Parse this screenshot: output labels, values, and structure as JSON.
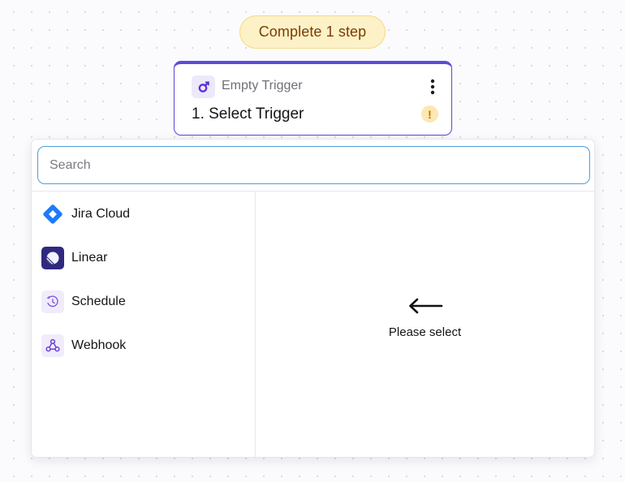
{
  "badge": {
    "label": "Complete 1 step"
  },
  "trigger_card": {
    "type_label": "Empty Trigger",
    "title": "1. Select Trigger",
    "icon": "trigger-icon",
    "warning_icon": "exclamation-icon",
    "warning_symbol": "!",
    "accent_color": "#5b4bd8"
  },
  "search": {
    "placeholder": "Search",
    "value": ""
  },
  "integrations": [
    {
      "label": "Jira Cloud",
      "icon": "jira-cloud-icon"
    },
    {
      "label": "Linear",
      "icon": "linear-icon"
    },
    {
      "label": "Schedule",
      "icon": "schedule-icon"
    },
    {
      "label": "Webhook",
      "icon": "webhook-icon"
    }
  ],
  "empty_state": {
    "icon": "left-arrow-icon",
    "text": "Please select"
  },
  "colors": {
    "badge_background": "#fdf1c7",
    "badge_text": "#7a3d05",
    "search_focus_border": "#4d9ed8",
    "jira_blue": "#1d7afc"
  }
}
